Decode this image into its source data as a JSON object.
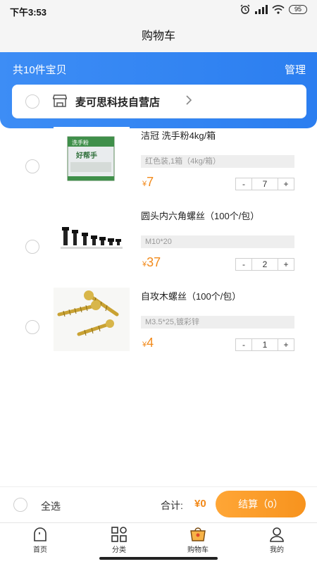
{
  "status_bar": {
    "time": "下午3:53",
    "battery": "95"
  },
  "header": {
    "title": "购物车"
  },
  "cart_summary": {
    "count_text": "共10件宝贝",
    "manage_label": "管理"
  },
  "shop": {
    "name": "麦可思科技自营店"
  },
  "items": [
    {
      "name": "洁冠 洗手粉4kg/箱",
      "spec": "红色装,1箱（4kg/箱）",
      "currency": "¥",
      "price": "7",
      "quantity": "7",
      "minus": "-",
      "plus": "+"
    },
    {
      "name": "圆头内六角螺丝（100个/包）",
      "spec": "M10*20",
      "currency": "¥",
      "price": "37",
      "quantity": "2",
      "minus": "-",
      "plus": "+"
    },
    {
      "name": "自攻木螺丝（100个/包）",
      "spec": "M3.5*25,镀彩锌",
      "currency": "¥",
      "price": "4",
      "quantity": "1",
      "minus": "-",
      "plus": "+"
    }
  ],
  "product_image_text": {
    "powder_bag_label": "洗手粉",
    "powder_bag_brand": "好帮手"
  },
  "footer": {
    "select_all": "全选",
    "total_label": "合计:",
    "total_amount": "¥0",
    "checkout_label": "结算（0）"
  },
  "tabs": [
    {
      "label": "首页",
      "icon": "home-icon"
    },
    {
      "label": "分类",
      "icon": "category-icon"
    },
    {
      "label": "购物车",
      "icon": "cart-icon",
      "active": true
    },
    {
      "label": "我的",
      "icon": "profile-icon"
    }
  ],
  "colors": {
    "accent_blue": "#2b7ef0",
    "price_orange": "#f28a1b",
    "checkout_orange": "#f7931e"
  }
}
